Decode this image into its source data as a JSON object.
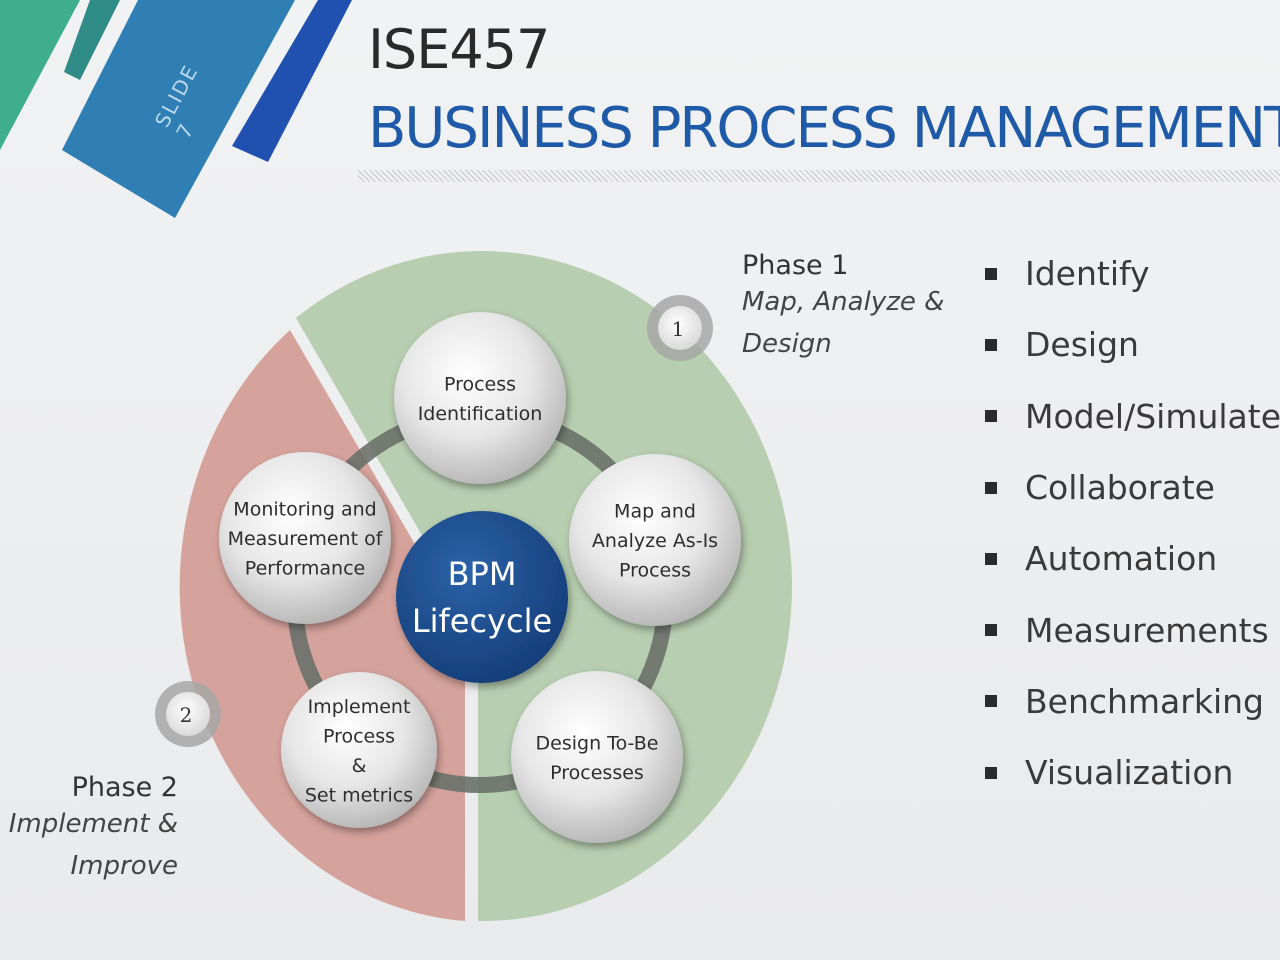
{
  "header": {
    "course_code": "ISE457",
    "title": "BUSINESS PROCESS MANAGEMENT",
    "slide_label": "SLIDE 7"
  },
  "diagram": {
    "center_label": [
      "BPM",
      "Lifecycle"
    ],
    "nodes": [
      {
        "lines": [
          "Process",
          "Identification"
        ]
      },
      {
        "lines": [
          "Map and",
          "Analyze As-Is",
          "Process"
        ]
      },
      {
        "lines": [
          "Design To-Be",
          "Processes"
        ]
      },
      {
        "lines": [
          "Implement",
          "Process",
          "&",
          "Set metrics"
        ]
      },
      {
        "lines": [
          "Monitoring and",
          "Measurement of",
          "Performance"
        ]
      }
    ],
    "phase1": {
      "badge": "1",
      "title": "Phase 1",
      "subtitle_lines": [
        "Map, Analyze &",
        "Design"
      ]
    },
    "phase2": {
      "badge": "2",
      "title": "Phase 2",
      "subtitle_lines": [
        "Implement &",
        "Improve"
      ]
    }
  },
  "bullets": [
    "Identify",
    "Design",
    "Model/Simulate",
    "Collaborate",
    "Automation",
    "Measurements",
    "Benchmarking",
    "Visualization"
  ],
  "colors": {
    "title_blue": "#1f5aa8",
    "center_circle": "#1a4a8c",
    "phase1_fill": "#b7ceb0",
    "phase2_fill": "#d6a29c",
    "ring": "#6c716c"
  }
}
